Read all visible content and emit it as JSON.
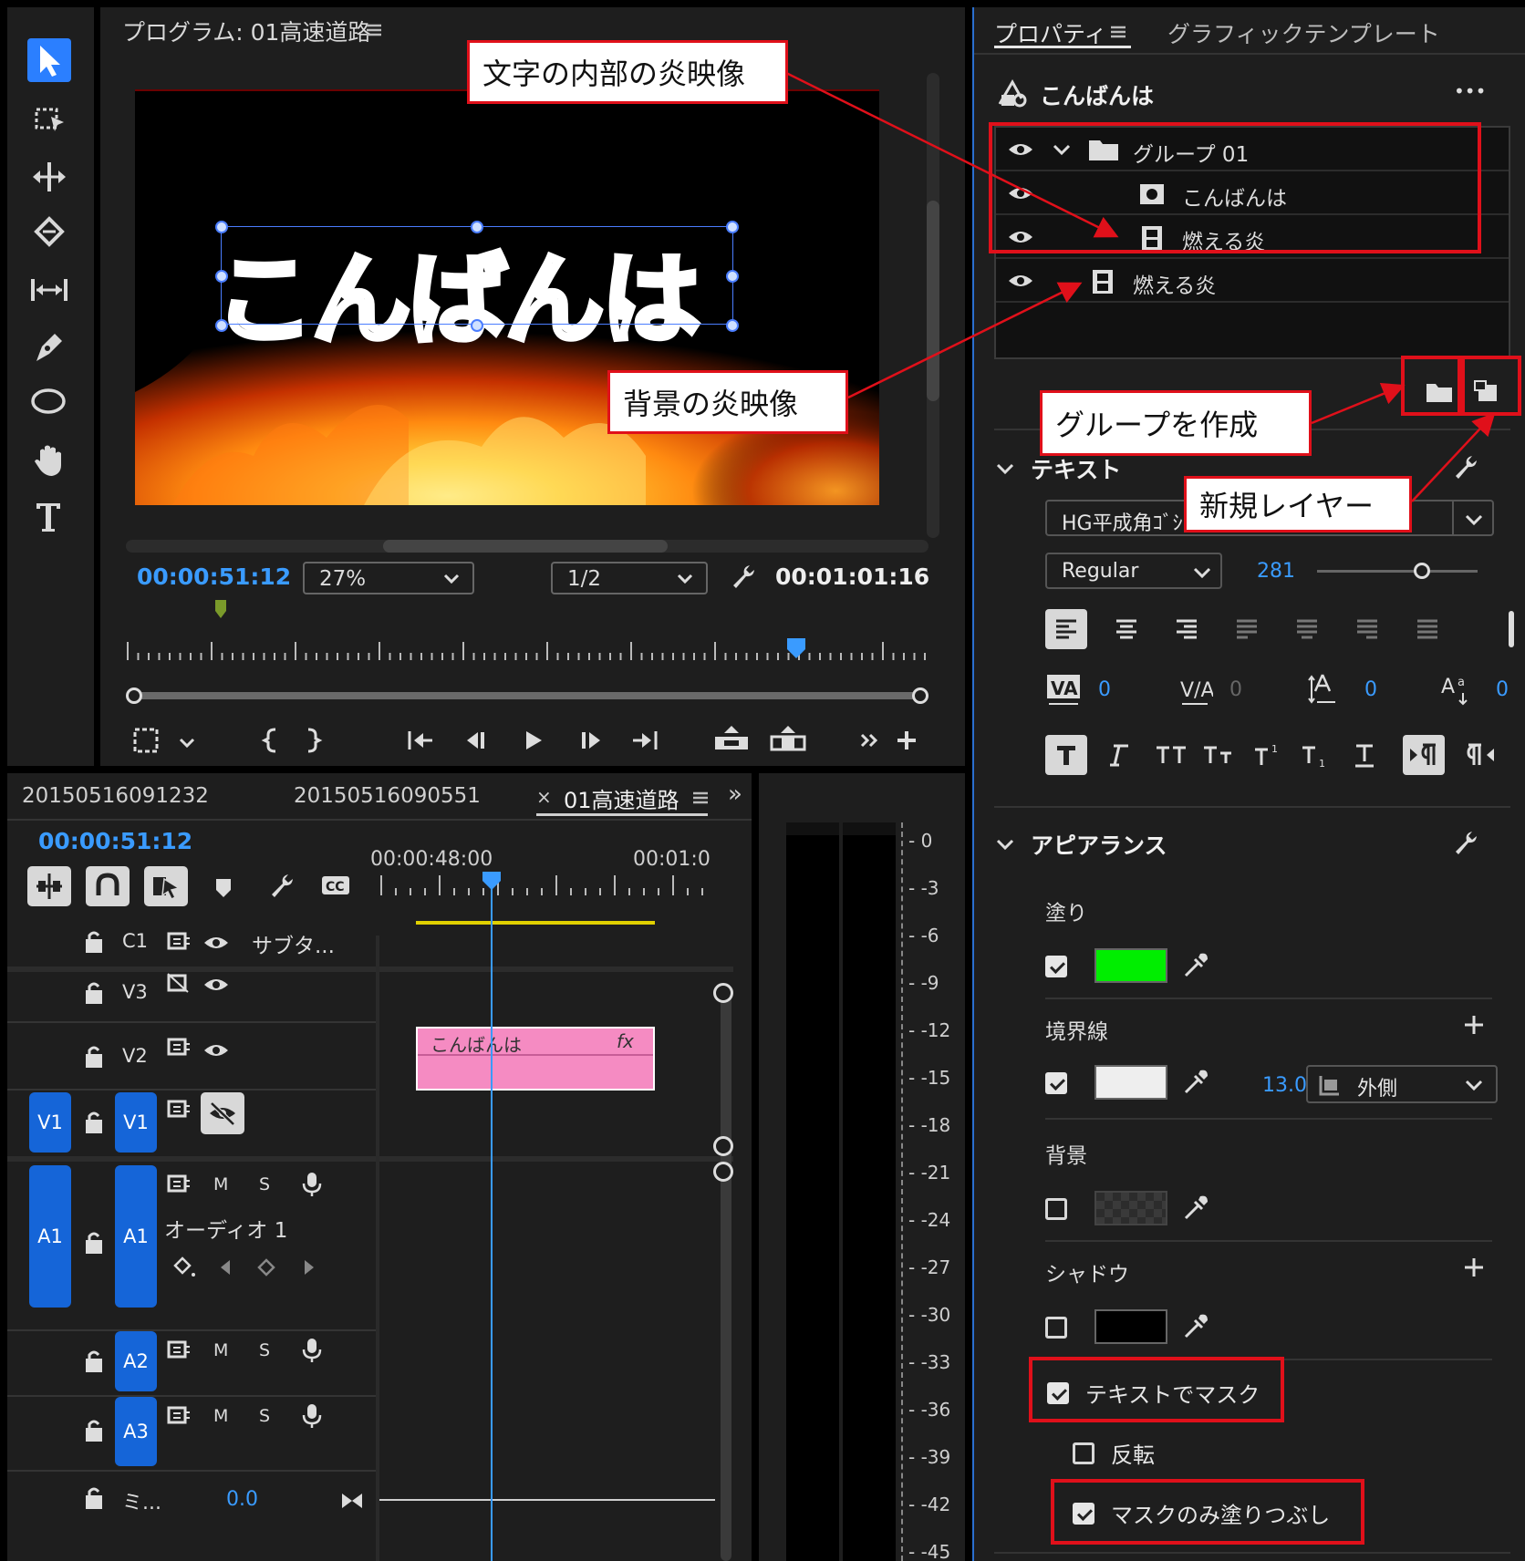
{
  "program": {
    "title": "プログラム: 01高速道路",
    "menu_icon": "hamburger-icon",
    "current_time": "00:00:51:12",
    "zoom": "27%",
    "resolution": "1/2",
    "duration": "00:01:01:16",
    "title_text": "こんばんは"
  },
  "tools": [
    "selection-tool-icon",
    "track-select-icon",
    "ripple-edit-icon",
    "razor-icon",
    "slip-icon",
    "pen-icon",
    "ellipse-icon",
    "hand-icon",
    "type-icon"
  ],
  "callouts": {
    "inner_fire": "文字の内部の炎映像",
    "bg_fire": "背景の炎映像",
    "create_group": "グループを作成",
    "new_layer": "新規レイヤー"
  },
  "properties": {
    "tab_properties": "プロパティ",
    "tab_graphics": "グラフィックテンプレート",
    "object_name": "こんばんは",
    "more": "•••",
    "layers": [
      {
        "name": "グループ 01",
        "icon": "folder-icon"
      },
      {
        "name": "こんばんは",
        "icon": "text-layer-icon"
      },
      {
        "name": "燃える炎",
        "icon": "film-icon"
      },
      {
        "name": "燃える炎",
        "icon": "film-icon"
      }
    ],
    "text_section": "テキスト",
    "font": "HG平成角ｺﾞｼ",
    "style": "Regular",
    "size": "281",
    "tracking_values": [
      "0",
      "0",
      "0",
      "0"
    ],
    "appearance_section": "アピアランス",
    "fill_label": "塗り",
    "fill_color": "#00ee00",
    "stroke_label": "境界線",
    "stroke_color": "#eeeeee",
    "stroke_width": "13.0",
    "stroke_pos": "外側",
    "background_label": "背景",
    "shadow_label": "シャドウ",
    "shadow_color": "#000000",
    "mask_text": "テキストでマスク",
    "invert": "反転",
    "mask_fill": "マスクのみ塗りつぶし"
  },
  "timeline": {
    "tabs": [
      "20150516091232",
      "20150516090551",
      "01高速道路"
    ],
    "close": "×",
    "more": "»",
    "current_time": "00:00:51:12",
    "ruler_labels": [
      "00:00:48:00",
      "00:01:0"
    ],
    "tracks": {
      "c1": "C1",
      "c1_name": "サブタ...",
      "v3": "V3",
      "v2": "V2",
      "v1": "V1",
      "a1": "A1",
      "a1_name": "オーディオ 1",
      "a2": "A2",
      "a3": "A3",
      "mix": "ミ...",
      "mix_val": "0.0",
      "m": "M",
      "s": "S"
    },
    "clip_name": "こんばんは",
    "clip_fx": "fx"
  },
  "meter": [
    "0",
    "-3",
    "-6",
    "-9",
    "-12",
    "-15",
    "-18",
    "-21",
    "-24",
    "-27",
    "-30",
    "-33",
    "-36",
    "-39",
    "-42",
    "-45"
  ]
}
